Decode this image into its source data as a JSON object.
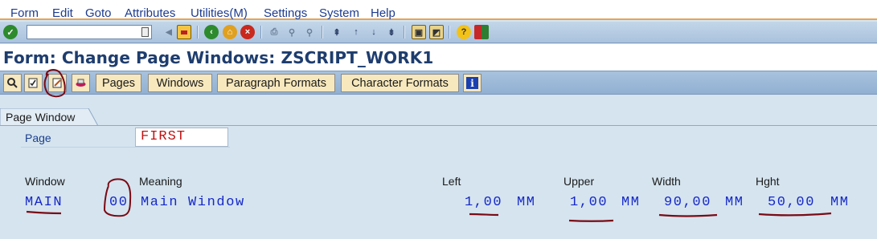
{
  "menu": [
    "Form",
    "Edit",
    "Goto",
    "Attributes",
    "Utilities(M)",
    "Settings",
    "System",
    "Help"
  ],
  "title": "Form: Change Page Windows: ZSCRIPT_WORK1",
  "app_toolbar": {
    "pages": "Pages",
    "windows": "Windows",
    "paragraph_formats": "Paragraph Formats",
    "character_formats": "Character Formats"
  },
  "tab": {
    "label": "Page Window"
  },
  "page": {
    "label": "Page",
    "value": "FIRST"
  },
  "columns": {
    "window": "Window",
    "meaning": "Meaning",
    "left": "Left",
    "upper": "Upper",
    "width": "Width",
    "hght": "Hght"
  },
  "row": {
    "window": "MAIN",
    "code": "00",
    "meaning": "Main Window",
    "left": "1,00",
    "left_unit": "MM",
    "upper": "1,00",
    "upper_unit": "MM",
    "width": "90,00",
    "width_unit": "MM",
    "hght": "50,00",
    "hght_unit": "MM"
  },
  "icons": {
    "enter": "enter-check-icon",
    "save": "save-icon",
    "back": "back-icon",
    "exit": "exit-icon",
    "cancel": "cancel-icon",
    "print": "print-icon",
    "find": "find-icon",
    "help": "help-icon"
  },
  "colors": {
    "annotation": "#7a0a14",
    "value_text": "#1628c8",
    "page_value": "#c21212",
    "title": "#1e3d6e"
  }
}
